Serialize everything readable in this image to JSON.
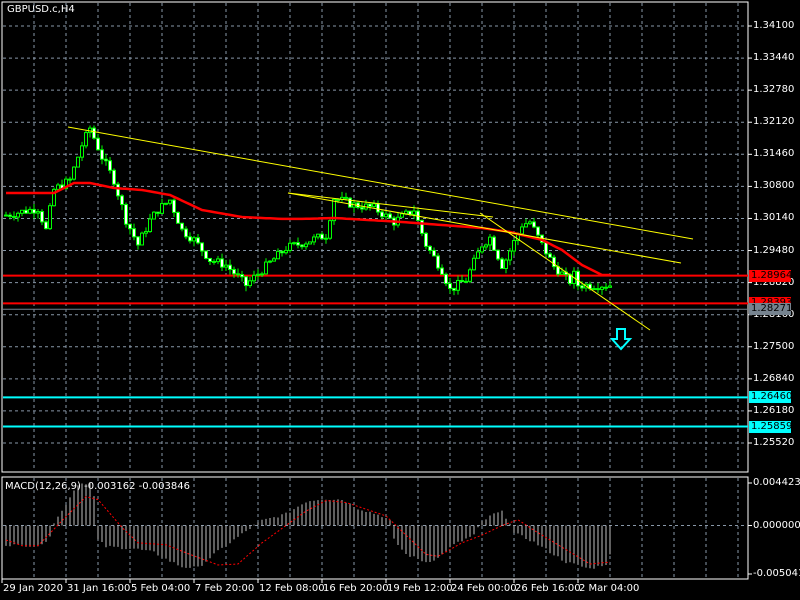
{
  "chart_title": "GBPUSD.c,H4",
  "colors": {
    "background": "#000000",
    "grid": "#8897a8",
    "candle_outline": "#00ff00",
    "bull_fill": "#000000",
    "bear_fill": "#ffffff",
    "ma": "#ff0000",
    "trendline": "#ffff00",
    "support": "#00ffff",
    "resistance": "#ff0000",
    "bid": "#76838f"
  },
  "chart_data": {
    "type": "candlestick",
    "symbol": "GBPUSD.c",
    "timeframe": "H4",
    "ylim": [
      1.2552,
      1.341
    ],
    "price_ticks": [
      "1.34100",
      "1.33440",
      "1.32780",
      "1.32120",
      "1.31460",
      "1.30800",
      "1.30140",
      "1.29480",
      "1.28820",
      "1.28160",
      "1.27500",
      "1.26840",
      "1.26180",
      "1.25520"
    ],
    "time_labels": [
      "29 Jan 2020",
      "31 Jan 16:00",
      "5 Feb 04:00",
      "7 Feb 20:00",
      "12 Feb 08:00",
      "16 Feb 20:00",
      "19 Feb 12:00",
      "24 Feb 00:00",
      "26 Feb 16:00",
      "2 Mar 04:00"
    ],
    "bar_count": 152,
    "close_anchors": [
      [
        0,
        1.3021
      ],
      [
        8,
        1.3035
      ],
      [
        10,
        1.299
      ],
      [
        12,
        1.3073
      ],
      [
        16,
        1.3093
      ],
      [
        19,
        1.3165
      ],
      [
        21,
        1.32
      ],
      [
        24,
        1.314
      ],
      [
        27,
        1.3093
      ],
      [
        30,
        1.3011
      ],
      [
        33,
        1.296
      ],
      [
        36,
        1.301
      ],
      [
        38,
        1.3032
      ],
      [
        41,
        1.3052
      ],
      [
        44,
        1.299
      ],
      [
        47,
        1.297
      ],
      [
        51,
        1.2929
      ],
      [
        55,
        1.2918
      ],
      [
        60,
        1.2877
      ],
      [
        64,
        1.2908
      ],
      [
        70,
        1.2953
      ],
      [
        75,
        1.2966
      ],
      [
        80,
        1.298
      ],
      [
        82,
        1.3056
      ],
      [
        87,
        1.3042
      ],
      [
        92,
        1.3036
      ],
      [
        97,
        1.3007
      ],
      [
        102,
        1.3032
      ],
      [
        105,
        1.296
      ],
      [
        109,
        1.2908
      ],
      [
        111,
        1.2867
      ],
      [
        115,
        1.2888
      ],
      [
        119,
        1.296
      ],
      [
        124,
        1.2918
      ],
      [
        129,
        1.3001
      ],
      [
        121,
        1.2975
      ],
      [
        131,
        1.3007
      ],
      [
        125,
        1.293
      ],
      [
        134,
        1.296
      ],
      [
        138,
        1.2908
      ],
      [
        142,
        1.2898
      ],
      [
        136,
        1.293
      ],
      [
        139,
        1.29
      ],
      [
        137,
        1.2915
      ],
      [
        140,
        1.289
      ],
      [
        141,
        1.2885
      ],
      [
        143,
        1.2877
      ],
      [
        139,
        1.2905
      ]
    ],
    "ma_anchors": [
      [
        0,
        1.30664
      ],
      [
        12,
        1.30664
      ],
      [
        17,
        1.3087
      ],
      [
        21,
        1.3087
      ],
      [
        27,
        1.30767
      ],
      [
        34,
        1.30726
      ],
      [
        41,
        1.30623
      ],
      [
        49,
        1.30315
      ],
      [
        59,
        1.30171
      ],
      [
        69,
        1.3013
      ],
      [
        74,
        1.3013
      ],
      [
        82,
        1.3015
      ],
      [
        99,
        1.30068
      ],
      [
        109,
        1.30006
      ],
      [
        119,
        1.29944
      ],
      [
        126,
        1.29862
      ],
      [
        134,
        1.29698
      ],
      [
        139,
        1.29492
      ],
      [
        144,
        1.29183
      ],
      [
        149,
        1.28977
      ],
      [
        151,
        1.28977
      ]
    ],
    "levels": [
      {
        "label": "1.28964",
        "price": 1.28964,
        "type": "resistance"
      },
      {
        "label": "1.28393",
        "price": 1.28393,
        "type": "resistance"
      },
      {
        "label": "1.28271",
        "price": 1.28271,
        "type": "bid"
      },
      {
        "label": "1.26460",
        "price": 1.2646,
        "type": "support"
      },
      {
        "label": "1.25859",
        "price": 1.25859,
        "type": "support"
      }
    ],
    "macd": {
      "label": "MACD(12,26,9) -0.003162 -0.003846",
      "ticks": [
        "0.004423",
        "0.000000",
        "-0.005041"
      ],
      "ylim": [
        -0.005041,
        0.004423
      ],
      "hist_anchors": [
        [
          0,
          -0.002
        ],
        [
          9,
          -0.0021
        ],
        [
          11,
          -0.001
        ],
        [
          12,
          0.0003
        ],
        [
          14,
          0.0015
        ],
        [
          16,
          0.003
        ],
        [
          18,
          0.0043
        ],
        [
          21,
          0.0045
        ],
        [
          22,
          0.003
        ],
        [
          23,
          -0.0015
        ],
        [
          25,
          -0.0022
        ],
        [
          32,
          -0.0024
        ],
        [
          37,
          -0.0028
        ],
        [
          40,
          -0.0035
        ],
        [
          44,
          -0.0043
        ],
        [
          48,
          -0.0044
        ],
        [
          52,
          -0.003
        ],
        [
          58,
          -0.0012
        ],
        [
          62,
          0.0
        ],
        [
          64,
          0.0005
        ],
        [
          70,
          0.0012
        ],
        [
          75,
          0.0025
        ],
        [
          79,
          0.0028
        ],
        [
          84,
          0.0027
        ],
        [
          88,
          0.0018
        ],
        [
          94,
          0.001
        ],
        [
          96,
          0.0005
        ],
        [
          97,
          -0.0015
        ],
        [
          100,
          -0.003
        ],
        [
          105,
          -0.0038
        ],
        [
          108,
          -0.0034
        ],
        [
          112,
          -0.002
        ],
        [
          117,
          -0.001
        ],
        [
          119,
          0.0004
        ],
        [
          122,
          0.0012
        ],
        [
          124,
          0.0014
        ],
        [
          126,
          0.0003
        ],
        [
          127,
          -0.0008
        ],
        [
          131,
          -0.0015
        ],
        [
          135,
          -0.0025
        ],
        [
          140,
          -0.0038
        ],
        [
          146,
          -0.0045
        ],
        [
          150,
          -0.004
        ],
        [
          151,
          -0.0031
        ]
      ],
      "signal_anchors": [
        [
          0,
          -0.0015
        ],
        [
          4,
          -0.0021
        ],
        [
          8,
          -0.0021
        ],
        [
          14,
          0.0005
        ],
        [
          20,
          0.003
        ],
        [
          23,
          0.0027
        ],
        [
          29,
          -0.0002
        ],
        [
          33,
          -0.0018
        ],
        [
          40,
          -0.002
        ],
        [
          46,
          -0.003
        ],
        [
          53,
          -0.0041
        ],
        [
          58,
          -0.004
        ],
        [
          64,
          -0.0018
        ],
        [
          70,
          0.0
        ],
        [
          75,
          0.0015
        ],
        [
          80,
          0.0026
        ],
        [
          85,
          0.0024
        ],
        [
          95,
          0.001
        ],
        [
          100,
          -0.001
        ],
        [
          105,
          -0.003
        ],
        [
          108,
          -0.0032
        ],
        [
          114,
          -0.0018
        ],
        [
          119,
          -0.001
        ],
        [
          124,
          0.0
        ],
        [
          128,
          0.0006
        ],
        [
          132,
          -0.0005
        ],
        [
          140,
          -0.0025
        ],
        [
          146,
          -0.004
        ],
        [
          151,
          -0.0038
        ]
      ]
    }
  }
}
